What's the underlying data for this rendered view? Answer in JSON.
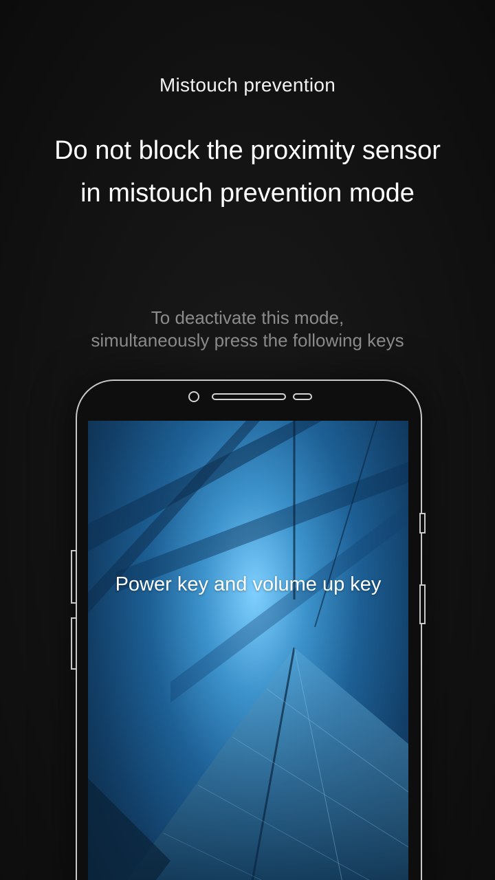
{
  "header": {
    "title": "Mistouch prevention",
    "headline_line1": "Do not block the proximity sensor",
    "headline_line2": "in mistouch prevention mode"
  },
  "hint": {
    "line1": "To deactivate this mode,",
    "line2": "simultaneously press the following keys"
  },
  "phone": {
    "screen_label": "Power key and volume up key"
  }
}
